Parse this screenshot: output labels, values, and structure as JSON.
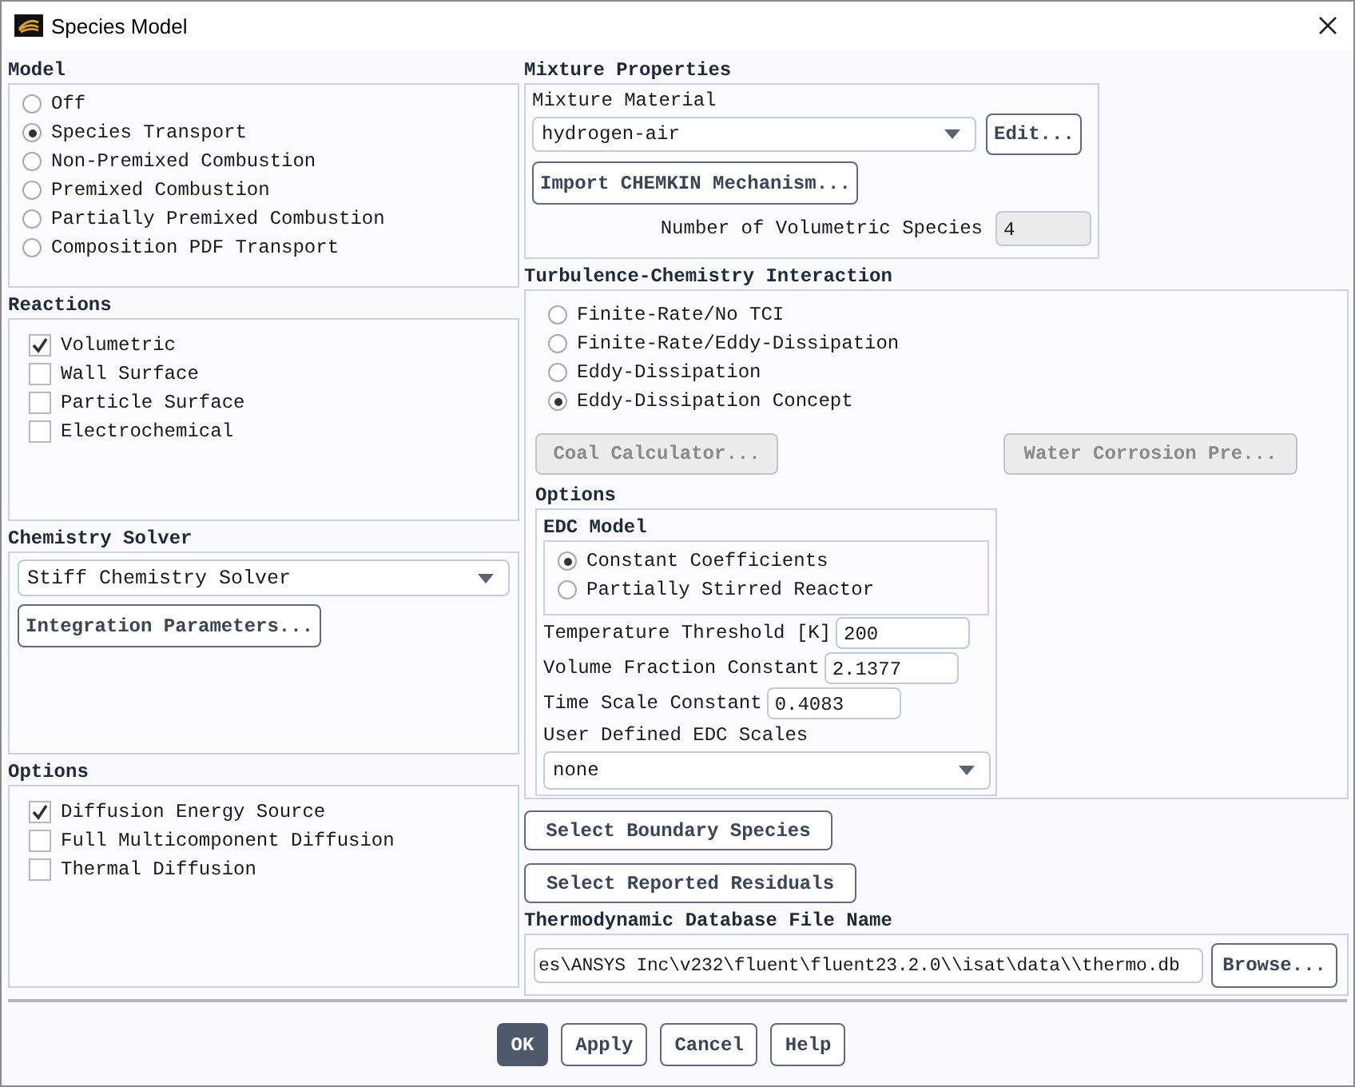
{
  "window": {
    "title": "Species Model"
  },
  "model": {
    "title": "Model",
    "options": [
      {
        "label": "Off",
        "selected": false
      },
      {
        "label": "Species Transport",
        "selected": true
      },
      {
        "label": "Non-Premixed Combustion",
        "selected": false
      },
      {
        "label": "Premixed Combustion",
        "selected": false
      },
      {
        "label": "Partially Premixed Combustion",
        "selected": false
      },
      {
        "label": "Composition PDF Transport",
        "selected": false
      }
    ]
  },
  "reactions": {
    "title": "Reactions",
    "items": [
      {
        "label": "Volumetric",
        "checked": true
      },
      {
        "label": "Wall Surface",
        "checked": false
      },
      {
        "label": "Particle Surface",
        "checked": false
      },
      {
        "label": "Electrochemical",
        "checked": false
      }
    ]
  },
  "chemistry_solver": {
    "title": "Chemistry Solver",
    "solver": "Stiff Chemistry Solver",
    "button": "Integration Parameters..."
  },
  "options": {
    "title": "Options",
    "items": [
      {
        "label": "Diffusion Energy Source",
        "checked": true
      },
      {
        "label": "Full Multicomponent Diffusion",
        "checked": false
      },
      {
        "label": "Thermal Diffusion",
        "checked": false
      }
    ]
  },
  "mixture_properties": {
    "title": "Mixture Properties",
    "material_label": "Mixture Material",
    "material": "hydrogen-air",
    "edit_button": "Edit...",
    "import_button": "Import CHEMKIN Mechanism...",
    "species_label": "Number of Volumetric Species",
    "species_count": "4"
  },
  "tci": {
    "title": "Turbulence-Chemistry Interaction",
    "options": [
      {
        "label": "Finite-Rate/No TCI",
        "selected": false
      },
      {
        "label": "Finite-Rate/Eddy-Dissipation",
        "selected": false
      },
      {
        "label": "Eddy-Dissipation",
        "selected": false
      },
      {
        "label": "Eddy-Dissipation Concept",
        "selected": true
      }
    ],
    "buttons": [
      {
        "label": "Coal Calculator...",
        "disabled": true
      },
      {
        "label": "Water Corrosion Pre...",
        "disabled": true
      }
    ],
    "options_title": "Options",
    "edc_title": "EDC Model",
    "edc_options": [
      {
        "label": "Constant Coefficients",
        "selected": true
      },
      {
        "label": "Partially Stirred Reactor",
        "selected": false
      }
    ],
    "fields": [
      {
        "label": "Temperature Threshold [K]",
        "value": "200"
      },
      {
        "label": "Volume Fraction Constant",
        "value": "2.1377"
      },
      {
        "label": "Time Scale Constant",
        "value": "0.4083"
      }
    ],
    "scales_label": "User Defined EDC Scales",
    "scales": "none"
  },
  "select_boundary_button": "Select Boundary Species",
  "select_residuals_button": "Select Reported Residuals",
  "thermo": {
    "title": "Thermodynamic Database File Name",
    "path": "es\\ANSYS Inc\\v232\\fluent\\fluent23.2.0\\\\isat\\data\\\\thermo.db",
    "browse_button": "Browse..."
  },
  "buttons": [
    {
      "label": "OK",
      "default": true
    },
    {
      "label": "Apply",
      "default": false
    },
    {
      "label": "Cancel",
      "default": false
    },
    {
      "label": "Help",
      "default": false
    }
  ]
}
